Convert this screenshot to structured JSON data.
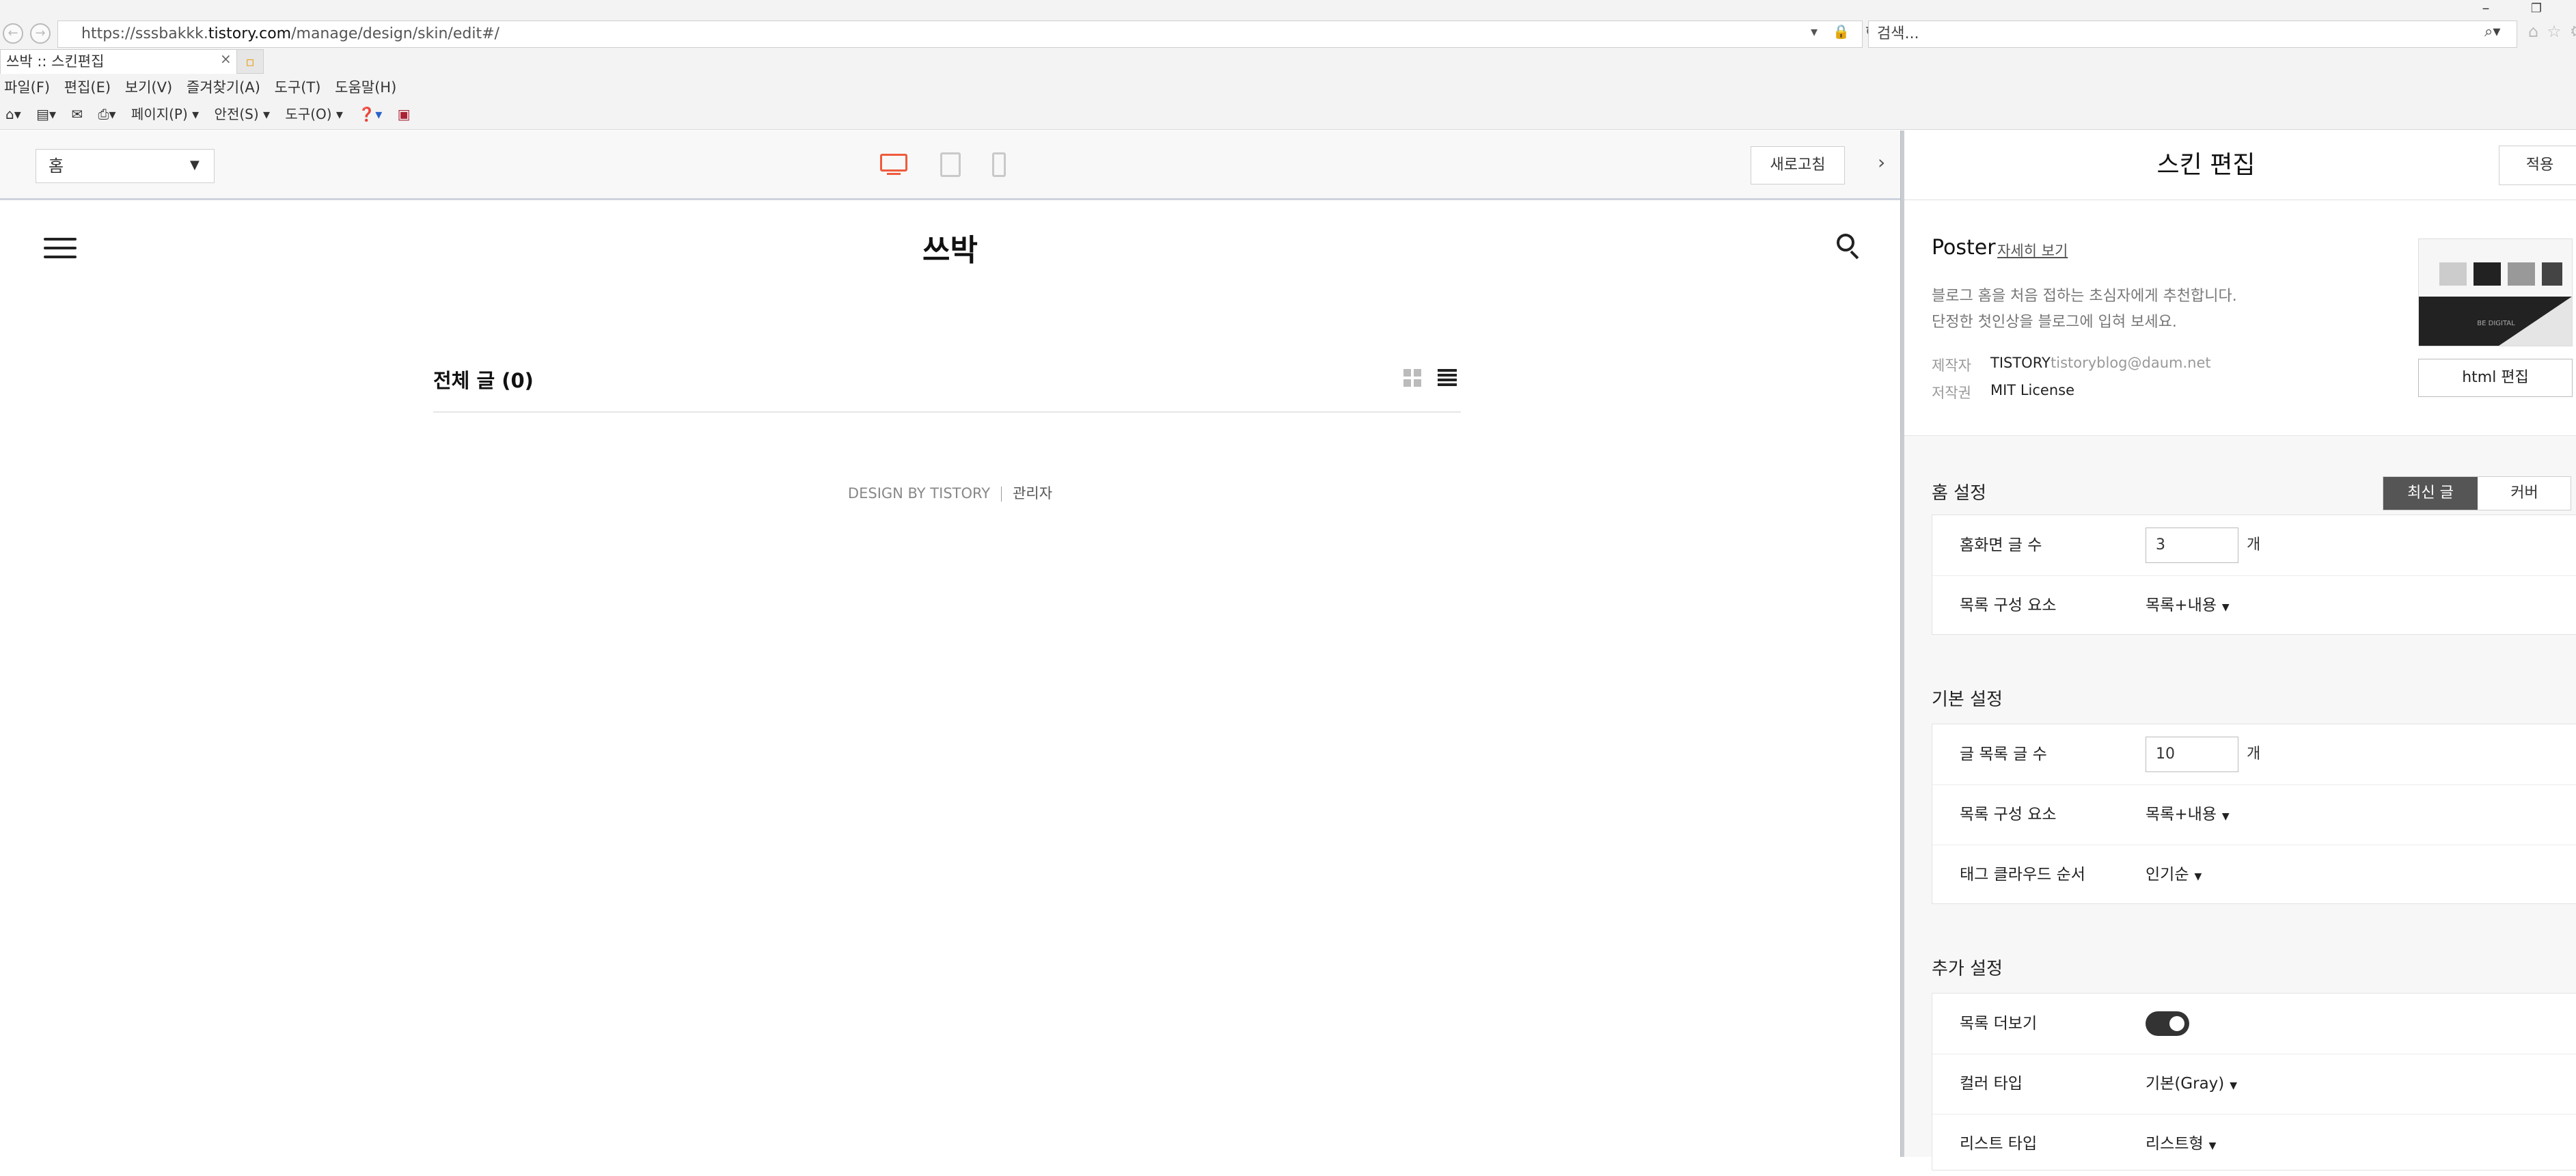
{
  "browser": {
    "url_prefix": "https://sssbakkk.",
    "url_domain": "tistory.com",
    "url_path": "/manage/design/skin/edit#/",
    "address_icons": "▾ 🔒 ↻",
    "search_placeholder": "검색...",
    "tab_title": "쓰박 :: 스킨편집",
    "menu": [
      "파일(F)",
      "편집(E)",
      "보기(V)",
      "즐겨찾기(A)",
      "도구(T)",
      "도움말(H)"
    ],
    "commands": [
      "페이지(P) ▾",
      "안전(S) ▾",
      "도구(O) ▾"
    ]
  },
  "toolbar": {
    "page_select": "홈",
    "refresh_label": "새로고침"
  },
  "preview": {
    "blog_title": "쓰박",
    "posts_heading": "전체 글 (0)",
    "footer_design": "DESIGN BY TISTORY",
    "footer_admin": "관리자"
  },
  "panel": {
    "title": "스킨 편집",
    "apply_label": "적용",
    "skin": {
      "name": "Poster",
      "detail_link": "자세히 보기",
      "desc_line1": "블로그 홈을 처음 접하는 초심자에게 추천합니다.",
      "desc_line2": "단정한 첫인상을 블로그에 입혀 보세요.",
      "maker_label": "제작자",
      "maker_value": "TISTORY",
      "maker_email": "tistoryblog@daum.net",
      "license_label": "저작권",
      "license_value": "MIT License",
      "thumb_caption": "BE DIGITAL",
      "html_edit_label": "html 편집"
    },
    "home": {
      "title": "홈 설정",
      "seg_latest": "최신 글",
      "seg_cover": "커버",
      "count_label": "홈화면 글 수",
      "count_value": "3",
      "unit": "개",
      "list_label": "목록 구성 요소",
      "list_value": "목록+내용"
    },
    "basic": {
      "title": "기본 설정",
      "count_label": "글 목록 글 수",
      "count_value": "10",
      "unit": "개",
      "list_label": "목록 구성 요소",
      "list_value": "목록+내용",
      "tag_label": "태그 클라우드 순서",
      "tag_value": "인기순"
    },
    "extra": {
      "title": "추가 설정",
      "more_label": "목록 더보기",
      "more_on": true,
      "color_label": "컬러 타입",
      "color_value": "기본(Gray)",
      "listtype_label": "리스트 타입",
      "listtype_value": "리스트형"
    }
  }
}
